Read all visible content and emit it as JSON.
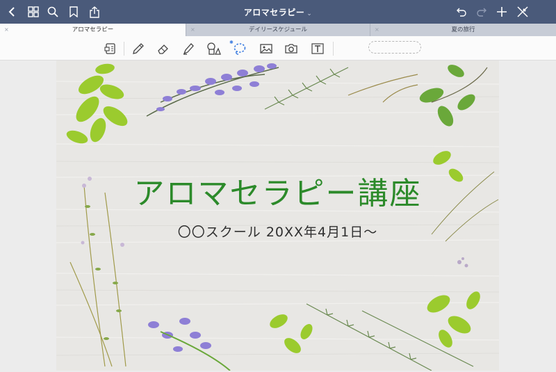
{
  "header": {
    "title": "アロマセラピー",
    "title_caret": "⌄",
    "icons": [
      "back-icon",
      "grid-icon",
      "search-icon",
      "bookmark-icon",
      "share-icon",
      "undo-icon",
      "redo-icon",
      "add-icon",
      "close-edit-icon"
    ]
  },
  "tabs": [
    {
      "label": "アロマセラピー",
      "close": "×",
      "active": true
    },
    {
      "label": "デイリースケジュール",
      "close": "×",
      "active": false
    },
    {
      "label": "夏の旅行",
      "close": "×",
      "active": false
    }
  ],
  "toolbar": {
    "tools": [
      "readonly-mode-icon",
      "pen-icon",
      "eraser-icon",
      "highlighter-icon",
      "shapes-icon",
      "lasso-icon",
      "image-icon",
      "camera-icon",
      "text-icon"
    ],
    "bluetooth_mark": "✱"
  },
  "page": {
    "headline": "アロマセラピー講座",
    "subtitle": "〇〇スクール 20XX年4月1日〜"
  },
  "colors": {
    "topbar": "#4a5a7a",
    "headline": "#2c8a2a",
    "lasso_active": "#3a7be0"
  }
}
